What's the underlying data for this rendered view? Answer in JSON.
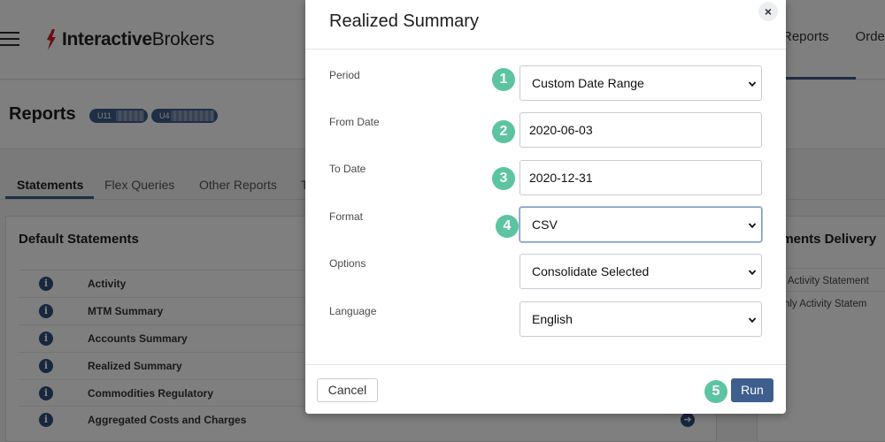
{
  "topbar": {
    "logo_bold": "Interactive",
    "logo_regular": "Brokers",
    "nav": [
      "Reports",
      "Orde"
    ]
  },
  "reports": {
    "title": "Reports",
    "accounts": [
      "U11",
      "U4"
    ]
  },
  "tabs": [
    "Statements",
    "Flex Queries",
    "Other Reports",
    "T"
  ],
  "default_statements": {
    "title": "Default Statements",
    "items": [
      "Activity",
      "MTM Summary",
      "Accounts Summary",
      "Realized Summary",
      "Commodities Regulatory",
      "Aggregated Costs and Charges"
    ]
  },
  "delivery": {
    "title": "tements Delivery",
    "items": [
      "aily Activity Statement",
      "onthly Activity Statem"
    ]
  },
  "modal": {
    "title": "Realized Summary",
    "close": "×",
    "fields": {
      "period": {
        "label": "Period",
        "value": "Custom Date Range",
        "step": "1"
      },
      "from_date": {
        "label": "From Date",
        "value": "2020-06-03",
        "step": "2"
      },
      "to_date": {
        "label": "To Date",
        "value": "2020-12-31",
        "step": "3"
      },
      "format": {
        "label": "Format",
        "value": "CSV",
        "step": "4"
      },
      "options": {
        "label": "Options",
        "value": "Consolidate Selected"
      },
      "language": {
        "label": "Language",
        "value": "English"
      }
    },
    "cancel_label": "Cancel",
    "run_label": "Run",
    "run_step": "5"
  },
  "colors": {
    "accent": "#3e5f8e",
    "step_badge": "#5cc4a0",
    "brand_red": "#d81f26"
  },
  "icons": {
    "info": "info-icon",
    "arrow": "arrow-right-icon",
    "caret": "chevron-down-icon",
    "close": "close-icon"
  }
}
